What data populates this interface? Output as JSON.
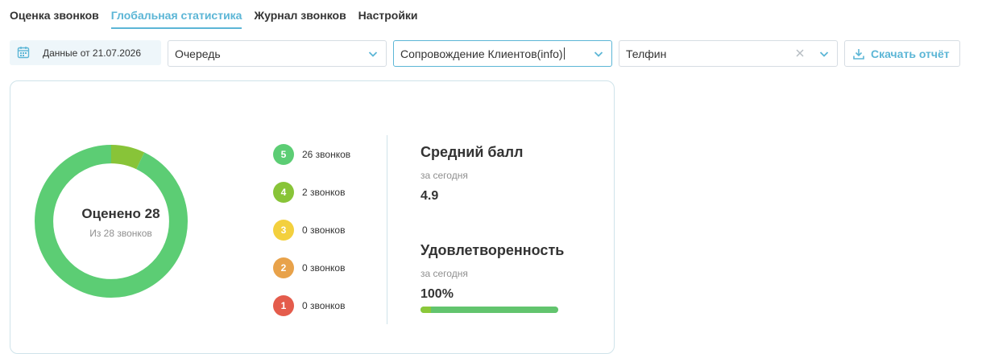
{
  "tabs": [
    {
      "label": "Оценка звонков",
      "active": false
    },
    {
      "label": "Глобальная статистика",
      "active": true
    },
    {
      "label": "Журнал звонков",
      "active": false
    },
    {
      "label": "Настройки",
      "active": false
    }
  ],
  "filters": {
    "date_label": "Данные от 21.07.2026",
    "queue_placeholder": "Очередь",
    "queue_value": "Сопровождение Клиентов(info)",
    "provider_value": "Телфин",
    "download_label": "Скачать отчёт"
  },
  "summary": {
    "rated_title": "Оценено 28",
    "rated_sub": "Из 28 звонков",
    "rated_count": 28,
    "total_count": 28
  },
  "ratings": [
    {
      "score": "5",
      "label": "26 звонков",
      "count": 26,
      "color": "#5ccd74"
    },
    {
      "score": "4",
      "label": "2 звонков",
      "count": 2,
      "color": "#88c438"
    },
    {
      "score": "3",
      "label": "0 звонков",
      "count": 0,
      "color": "#f3d03e"
    },
    {
      "score": "2",
      "label": "0 звонков",
      "count": 0,
      "color": "#e8a24a"
    },
    {
      "score": "1",
      "label": "0 звонков",
      "count": 0,
      "color": "#e45c4c"
    }
  ],
  "stats": {
    "avg_title": "Средний балл",
    "avg_sub": "за сегодня",
    "avg_value": "4.9",
    "sat_title": "Удовлетворенность",
    "sat_sub": "за сегодня",
    "sat_value": "100%",
    "sat_percent": 100
  },
  "colors": {
    "accent": "#5cb6d6",
    "border": "#d6dde3",
    "card_border": "#cfe3ea"
  }
}
